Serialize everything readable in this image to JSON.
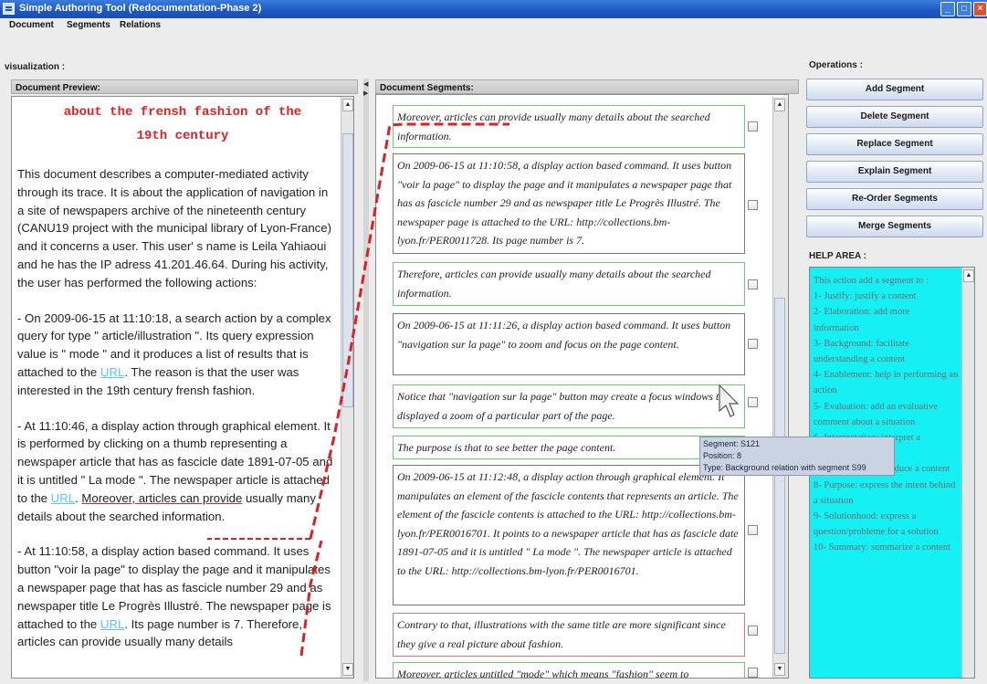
{
  "window": {
    "title": "Simple Authoring Tool (Redocumentation-Phase 2)"
  },
  "menu": [
    "Document",
    "Segments",
    "Relations"
  ],
  "labels": {
    "visualization": "visualization :",
    "operations": "Operations :",
    "help_area": "HELP AREA :",
    "document_preview": "Document Preview:",
    "document_segments": "Document Segments:"
  },
  "preview": {
    "title_line1": "about the frensh fashion of the",
    "title_line2": "19th century",
    "para1": "This document describes a computer-mediated activity through its trace. It is about the application of navigation in a site of newspapers archive of the nineteenth century (CANU19 project with the municipal library of Lyon-France) and it concerns a user. This user' s name is Leila Yahiaoui and he has the IP adress 41.201.46.64. During his activity, the user has performed the following actions:",
    "para2_a": "- On 2009-06-15 at 11:10:18, a search action by a complex query for type \" article/illustration \". Its query expression value is \" mode \" and it produces a list of results that is attached to the ",
    "para2_link": "URL",
    "para2_b": ". The reason is that the user was interested in the 19th century frensh fashion.",
    "para3_a": "- At 11:10:46, a display action through graphical element. It is performed by clicking on a thumb representing a newspaper article that has as fascicle date 1891-07-05 and it is untitled \" La mode \". The newspaper article is attached to the ",
    "para3_link": "URL",
    "para3_b": ". ",
    "para3_hl": "Moreover, articles can provide",
    "para3_c": " usually many details about the searched information.",
    "para4_a": "- At 11:10:58, a display action based command. It uses button \"voir la page\" to display the page and it manipulates a newspaper page that has as fascicle number 29 and as newspaper title Le Progrès Illustré. The newspaper page is attached to the ",
    "para4_link": "URL",
    "para4_b": ". Its page number is 7. Therefore, articles can provide usually many details"
  },
  "segments": [
    {
      "text": "Moreover, articles can provide usually many details about the searched information.",
      "style": "green"
    },
    {
      "text": "On 2009-06-15 at 11:10:58, a display action based command. It uses button \"voir la page\" to display the page and it manipulates a newspaper page that has as fascicle number  29 and as newspaper title Le Progrès Illustré. The newspaper page is attached to the URL: http://collections.bm-lyon.fr/PER0011728. Its page number is 7.",
      "style": "plain"
    },
    {
      "text": "Therefore, articles can provide usually many details about the searched information.",
      "style": "green"
    },
    {
      "text": "On 2009-06-15 at 11:11:26, a display action based command. It uses button \"navigation sur la page\" to zoom and focus on the page content.",
      "style": "plain"
    },
    {
      "text": "Notice that \"navigation sur la page\" button may create a focus windows to displayed a zoom of a particular part of the page.",
      "style": "green"
    },
    {
      "text": "The purpose is that to see better the page content.",
      "style": "green"
    },
    {
      "text": "On 2009-06-15 at 11:12:48, a display action through graphical element. It manipulates an element of the fascicle contents that represents an article. The element of the fascicle contents is attached to the URL: http://collections.bm-lyon.fr/PER0016701. It points to a newspaper article that has as fascicle date 1891-07-05 and it is untitled \" La mode \". The newspaper article is attached to the URL: http://collections.bm-lyon.fr/PER0016701.",
      "style": "plain"
    },
    {
      "text": "Contrary to that, illustrations with the same title are more significant  since they give a real picture about fashion.",
      "style": "red"
    },
    {
      "text": "Moreover, articles untitled \"mode\" which means \"fashion\" seem to",
      "style": "green"
    }
  ],
  "tooltip": {
    "line1": "Segment: S121",
    "line2": "Position: 8",
    "line3": "Type: Background relation with segment S99"
  },
  "operations": [
    "Add Segment",
    "Delete Segment",
    "Replace Segment",
    "Explain Segment",
    "Re-Order Segments",
    "Merge Segments"
  ],
  "help": [
    "This action add a segment to :",
    "1- Justify: justify a content",
    "2- Elaboration: add more",
    "information",
    "3- Background: facilitate",
    "understanding a content",
    "4- Enablement: help in performing an",
    "action",
    "5- Evaluation: add an evaluative",
    "comment about a situation",
    "6- Interpretation: interpret a",
    "situation",
    "7- Introduction: introduce a content",
    "8- Purpose: express the intent behind",
    "a situation",
    "9- Solutionhood: express a",
    "question/probleme for a solution",
    "10- Summary: summarize a content"
  ],
  "colors": {
    "title_bar": "#1d57c2",
    "preview_title": "#e02020",
    "link": "#59c5ff",
    "segment_green_border": "#6fca6f",
    "segment_red_border": "#d07a7a",
    "help_background": "#15f0f4",
    "connector_line": "#e02020"
  }
}
